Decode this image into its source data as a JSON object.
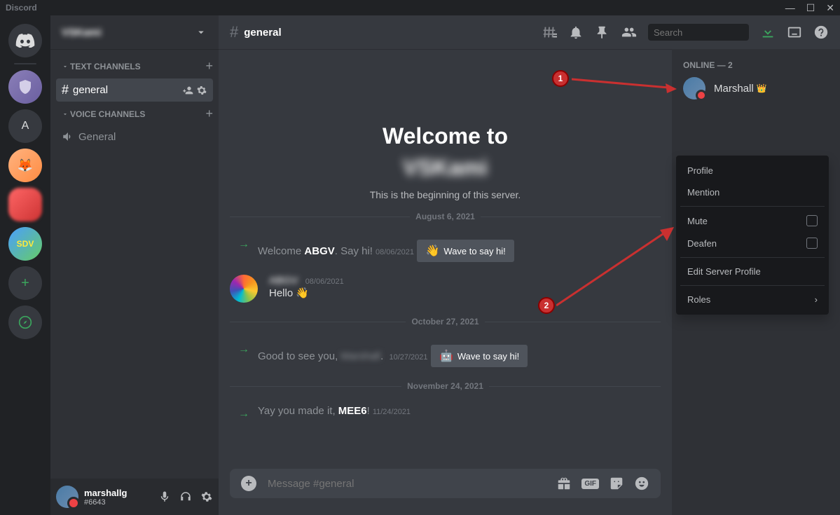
{
  "titlebar": {
    "app": "Discord"
  },
  "server_header": {
    "name": "VSKami"
  },
  "channel_categories": {
    "text": "TEXT CHANNELS",
    "voice": "VOICE CHANNELS"
  },
  "channels": {
    "general": "general",
    "voice_general": "General"
  },
  "user_panel": {
    "name": "marshallg",
    "tag": "#6643"
  },
  "header": {
    "channel": "general",
    "search_placeholder": "Search"
  },
  "welcome": {
    "line1": "Welcome to",
    "server": "VSKami",
    "subtitle": "This is the beginning of this server."
  },
  "dividers": {
    "d1": "August 6, 2021",
    "d2": "October 27, 2021",
    "d3": "November 24, 2021"
  },
  "messages": {
    "m1_pre": "Welcome ",
    "m1_bold": "ABGV",
    "m1_post": ". Say hi!",
    "m1_time": "08/06/2021",
    "wave_label": "Wave to say hi!",
    "m2_author": "ABGV",
    "m2_time": "08/06/2021",
    "m2_body": "Hello",
    "m3_pre": "Good to see you,",
    "m3_blur": "Marshall",
    "m3_time": "10/27/2021",
    "m4_pre": "Yay you made it, ",
    "m4_bold": "MEE6",
    "m4_post": "!",
    "m4_time": "11/24/2021"
  },
  "input": {
    "placeholder": "Message #general"
  },
  "members": {
    "header": "ONLINE — 2",
    "m1": "Marshall"
  },
  "context": {
    "profile": "Profile",
    "mention": "Mention",
    "mute": "Mute",
    "deafen": "Deafen",
    "edit": "Edit Server Profile",
    "roles": "Roles"
  },
  "annotations": {
    "a1": "1",
    "a2": "2"
  },
  "server_icons": {
    "sdv": "SDV",
    "letter": "A"
  }
}
